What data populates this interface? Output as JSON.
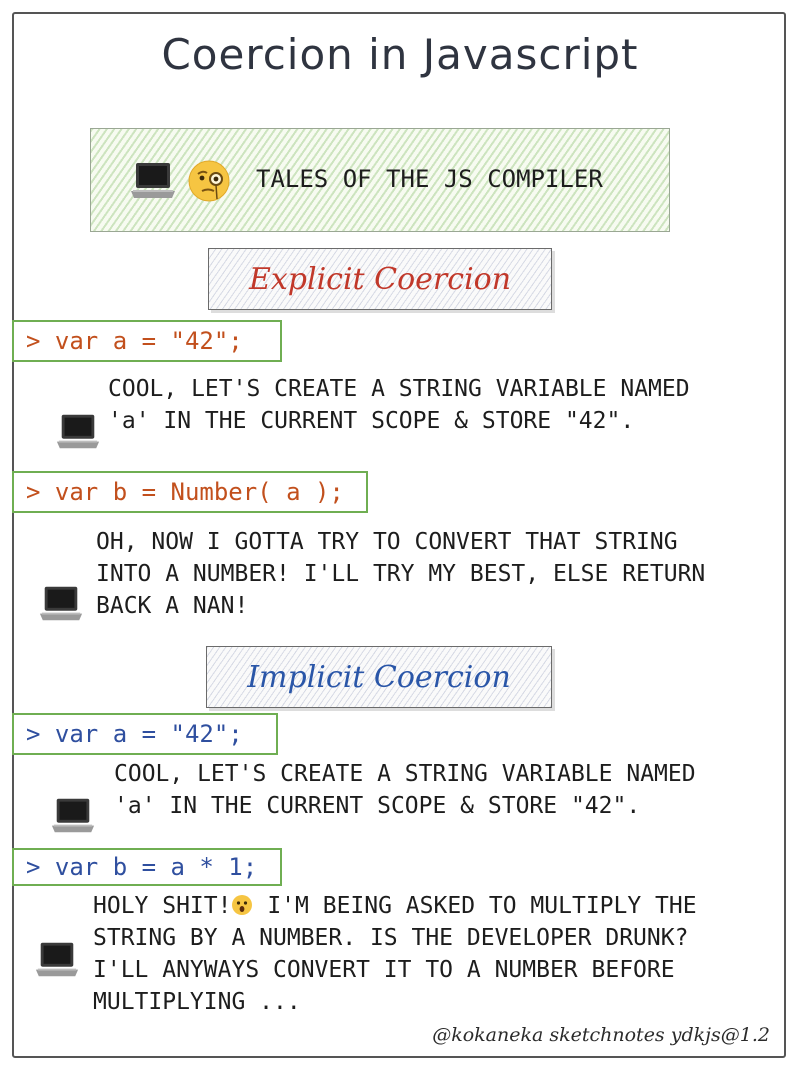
{
  "title": "Coercion in Javascript",
  "banner": {
    "text": "TALES OF THE JS COMPILER",
    "icons": [
      "laptop-icon",
      "monocle-face-icon"
    ]
  },
  "explicit": {
    "label": "Explicit Coercion",
    "color": "#c1382a",
    "code1": "> var a = \"42\";",
    "desc1": [
      "COOL, LET'S CREATE A STRING VARIABLE NAMED",
      "'a' IN THE CURRENT SCOPE & STORE \"42\"."
    ],
    "code2": "> var b = Number( a );",
    "desc2": [
      "OH, NOW I GOTTA TRY TO CONVERT THAT STRING",
      "INTO A NUMBER! I'LL TRY MY BEST, ELSE RETURN",
      "BACK A NAN!"
    ]
  },
  "implicit": {
    "label": "Implicit Coercion",
    "color": "#2a56a8",
    "code1": "> var a = \"42\";",
    "desc1": [
      "COOL, LET'S CREATE A STRING VARIABLE NAMED",
      "'a' IN THE CURRENT SCOPE & STORE \"42\"."
    ],
    "code2": "> var b = a * 1;",
    "desc2_line1_a": "HOLY SHIT!",
    "desc2_line1_b": " I'M BEING ASKED TO MULTIPLY THE",
    "desc2_rest": [
      "STRING BY A NUMBER. IS THE DEVELOPER DRUNK?",
      "I'LL ANYWAYS CONVERT IT TO A NUMBER BEFORE",
      "MULTIPLYING ..."
    ]
  },
  "credit": "@kokaneka sketchnotes ydkjs@1.2"
}
